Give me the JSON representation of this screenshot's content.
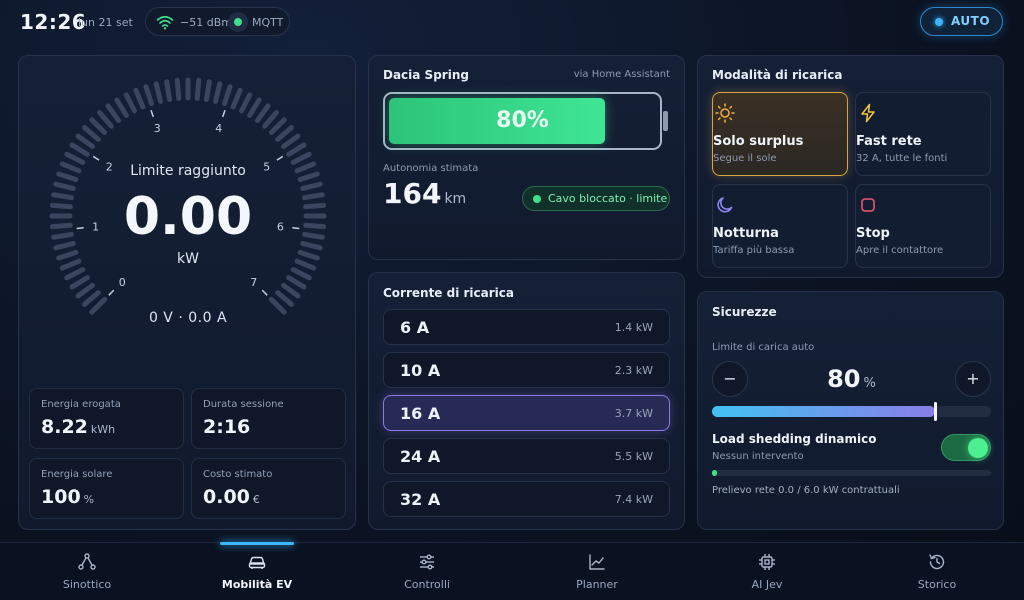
{
  "topbar": {
    "time": "12:26",
    "date": "lun 21 set",
    "signal": "−51 dBm",
    "mqtt_label": "MQTT",
    "auto_label": "AUTO"
  },
  "gauge": {
    "status": "Limite raggiunto",
    "value": "0.00",
    "unit": "kW",
    "voltage_current": "0 V · 0.0 A",
    "scale_min": 0,
    "scale_max": 7,
    "power_kw": 0.0,
    "tick_labels": [
      "0",
      "1",
      "2",
      "3",
      "4",
      "5",
      "6",
      "7"
    ]
  },
  "stats": [
    {
      "label": "Energia erogata",
      "value": "8.22",
      "unit": "kWh"
    },
    {
      "label": "Durata sessione",
      "value": "2:16",
      "unit": ""
    },
    {
      "label": "Energia solare",
      "value": "100",
      "unit": "%"
    },
    {
      "label": "Costo stimato",
      "value": "0.00",
      "unit": "€"
    }
  ],
  "vehicle": {
    "name": "Dacia Spring",
    "source": "via Home Assistant",
    "battery_label": "80%",
    "battery_fraction": 0.8,
    "range_label": "Autonomia stimata",
    "range_value": "164",
    "range_unit": "km",
    "cable_status": "Cavo bloccato · limite"
  },
  "current": {
    "title": "Corrente di ricarica",
    "options": [
      {
        "amps": "6 A",
        "kw": "1.4 kW",
        "selected": false
      },
      {
        "amps": "10 A",
        "kw": "2.3 kW",
        "selected": false
      },
      {
        "amps": "16 A",
        "kw": "3.7 kW",
        "selected": true
      },
      {
        "amps": "24 A",
        "kw": "5.5 kW",
        "selected": false
      },
      {
        "amps": "32 A",
        "kw": "7.4 kW",
        "selected": false
      }
    ]
  },
  "modes": {
    "title": "Modalità di ricarica",
    "items": [
      {
        "name": "Solo surplus",
        "desc": "Segue il sole",
        "icon": "sun-icon",
        "selected": true,
        "color": "#f2b23a"
      },
      {
        "name": "Fast rete",
        "desc": "32 A, tutte le fonti",
        "icon": "bolt-icon",
        "selected": false,
        "color": "#f2c53a"
      },
      {
        "name": "Notturna",
        "desc": "Tariffa più bassa",
        "icon": "moon-icon",
        "selected": false,
        "color": "#8f86f0"
      },
      {
        "name": "Stop",
        "desc": "Apre il contattore",
        "icon": "stop-icon",
        "selected": false,
        "color": "#ef5670"
      }
    ]
  },
  "safety": {
    "title": "Sicurezze",
    "limit_label": "Limite di carica auto",
    "limit_value": "80",
    "limit_unit": "%",
    "limit_fraction": 0.8,
    "minus": "−",
    "plus": "+",
    "load_shedding_title": "Load shedding dinamico",
    "load_shedding_status": "Nessun intervento",
    "load_shedding_on": true,
    "grid_fraction": 0.0,
    "grid_text": "Prelievo rete 0.0 / 6.0 kW contrattuali"
  },
  "nav": {
    "items": [
      {
        "label": "Sinottico",
        "icon": "network-icon",
        "active": false
      },
      {
        "label": "Mobilità EV",
        "icon": "car-icon",
        "active": true
      },
      {
        "label": "Controlli",
        "icon": "sliders-icon",
        "active": false
      },
      {
        "label": "Planner",
        "icon": "chart-line-icon",
        "active": false
      },
      {
        "label": "AI Jev",
        "icon": "chip-icon",
        "active": false
      },
      {
        "label": "Storico",
        "icon": "history-icon",
        "active": false
      }
    ]
  },
  "colors": {
    "accent": "#3cb7ff",
    "battery": "#3fe595",
    "selection": "#8b78e6",
    "mode_selected": "#d9a346"
  }
}
